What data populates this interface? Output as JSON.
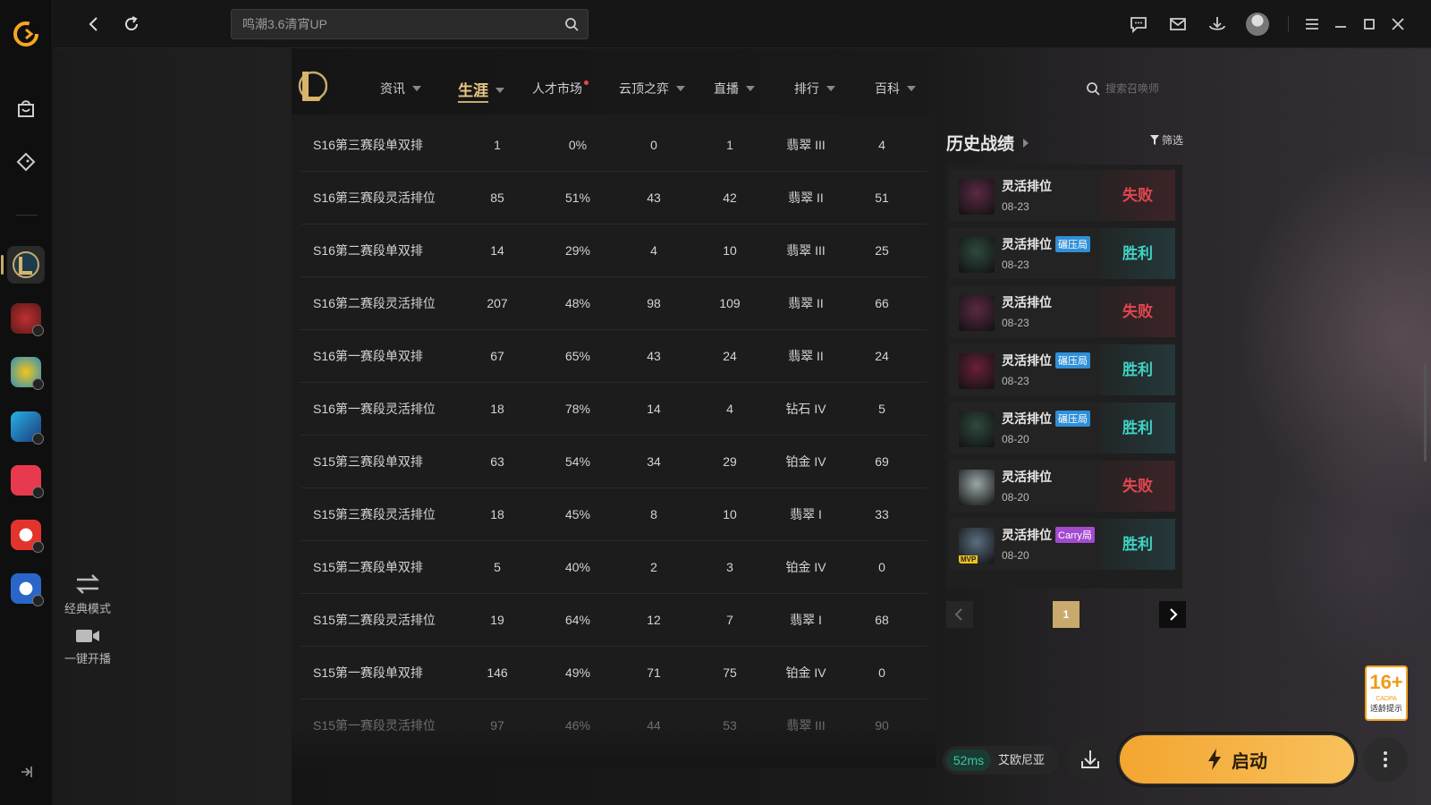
{
  "topbar": {
    "search_value": "鸣潮3.6清宵UP"
  },
  "leftpanel": {
    "classic_mode": "经典模式",
    "one_click_stream": "一键开播"
  },
  "nav": {
    "items": [
      "资讯",
      "生涯",
      "人才市场",
      "云顶之弈",
      "直播",
      "排行",
      "百科"
    ],
    "active": "生涯",
    "search_placeholder": "搜索召唤师"
  },
  "career_table": {
    "rows": [
      [
        "S16第三赛段单双排",
        "1",
        "0%",
        "0",
        "1",
        "翡翠 III",
        "4"
      ],
      [
        "S16第三赛段灵活排位",
        "85",
        "51%",
        "43",
        "42",
        "翡翠 II",
        "51"
      ],
      [
        "S16第二赛段单双排",
        "14",
        "29%",
        "4",
        "10",
        "翡翠 III",
        "25"
      ],
      [
        "S16第二赛段灵活排位",
        "207",
        "48%",
        "98",
        "109",
        "翡翠 II",
        "66"
      ],
      [
        "S16第一赛段单双排",
        "67",
        "65%",
        "43",
        "24",
        "翡翠 II",
        "24"
      ],
      [
        "S16第一赛段灵活排位",
        "18",
        "78%",
        "14",
        "4",
        "钻石 IV",
        "5"
      ],
      [
        "S15第三赛段单双排",
        "63",
        "54%",
        "34",
        "29",
        "铂金 IV",
        "69"
      ],
      [
        "S15第三赛段灵活排位",
        "18",
        "45%",
        "8",
        "10",
        "翡翠 I",
        "33"
      ],
      [
        "S15第二赛段单双排",
        "5",
        "40%",
        "2",
        "3",
        "铂金 IV",
        "0"
      ],
      [
        "S15第二赛段灵活排位",
        "19",
        "64%",
        "12",
        "7",
        "翡翠 I",
        "68"
      ],
      [
        "S15第一赛段单双排",
        "146",
        "49%",
        "71",
        "75",
        "铂金 IV",
        "0"
      ],
      [
        "S15第一赛段灵活排位",
        "97",
        "46%",
        "44",
        "53",
        "翡翠 III",
        "90"
      ]
    ]
  },
  "history": {
    "title": "历史战绩",
    "filter_label": "筛选",
    "matches": [
      {
        "mode": "灵活排位",
        "tag": "",
        "date": "08-23",
        "result": "失败",
        "win": false,
        "color": "#5a2a44"
      },
      {
        "mode": "灵活排位",
        "tag": "碾压局",
        "date": "08-23",
        "result": "胜利",
        "win": true,
        "color": "#2f4a3e"
      },
      {
        "mode": "灵活排位",
        "tag": "",
        "date": "08-23",
        "result": "失败",
        "win": false,
        "color": "#5a2a44"
      },
      {
        "mode": "灵活排位",
        "tag": "碾压局",
        "date": "08-23",
        "result": "胜利",
        "win": true,
        "color": "#6a2038"
      },
      {
        "mode": "灵活排位",
        "tag": "碾压局",
        "date": "08-20",
        "result": "胜利",
        "win": true,
        "color": "#2f4a3e"
      },
      {
        "mode": "灵活排位",
        "tag": "",
        "date": "08-20",
        "result": "失败",
        "win": false,
        "color": "#9aa6a8"
      },
      {
        "mode": "灵活排位",
        "tag": "Carry局",
        "date": "08-20",
        "result": "胜利",
        "win": true,
        "color": "#5a6e80",
        "mvp": "MVP"
      }
    ],
    "page": "1"
  },
  "bottom": {
    "ping": "52ms",
    "server": "艾欧尼亚",
    "launch_label": "启动"
  },
  "age_rating": {
    "number": "16+",
    "org": "CADPA",
    "tip": "适龄提示"
  }
}
